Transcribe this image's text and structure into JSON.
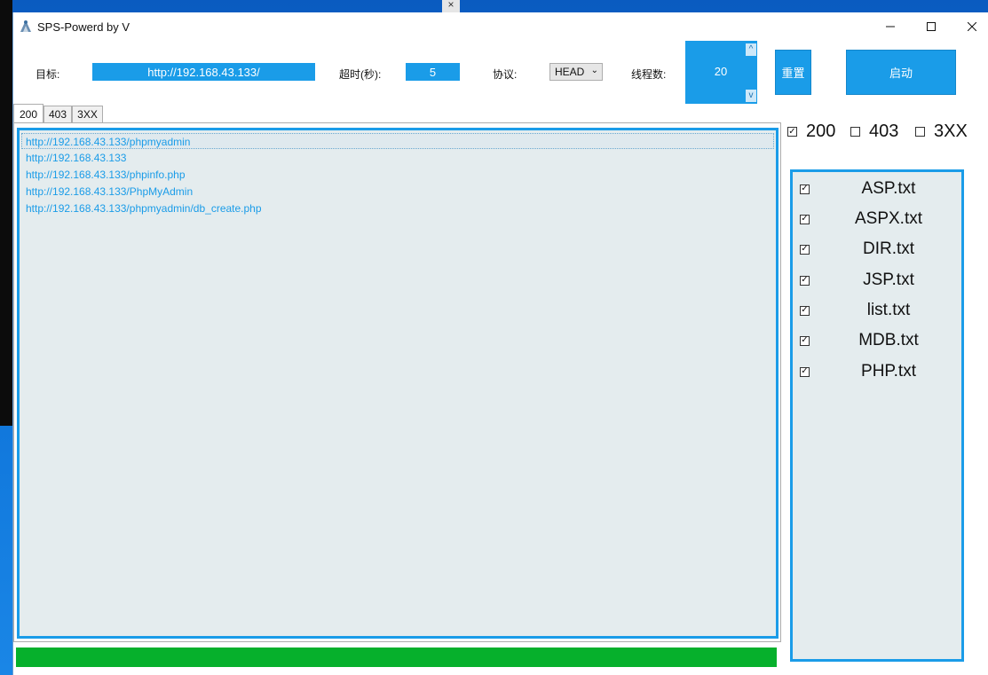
{
  "window": {
    "title": "SPS-Powerd by V"
  },
  "form": {
    "target_label": "目标:",
    "target_value": "http://192.168.43.133/",
    "timeout_label": "超时(秒):",
    "timeout_value": "5",
    "protocol_label": "协议:",
    "protocol_value": "HEAD",
    "threads_label": "线程数:",
    "threads_value": "20",
    "reset_label": "重置",
    "start_label": "启动"
  },
  "tabs": [
    {
      "label": "200",
      "active": true
    },
    {
      "label": "403",
      "active": false
    },
    {
      "label": "3XX",
      "active": false
    }
  ],
  "results": [
    "http://192.168.43.133/phpmyadmin",
    "http://192.168.43.133",
    "http://192.168.43.133/phpinfo.php",
    "http://192.168.43.133/PhpMyAdmin",
    "http://192.168.43.133/phpmyadmin/db_create.php"
  ],
  "progress_percent": 100,
  "status_filters": [
    {
      "label": "200",
      "checked": true
    },
    {
      "label": "403",
      "checked": false
    },
    {
      "label": "3XX",
      "checked": false
    }
  ],
  "dictionaries": [
    {
      "name": "ASP.txt",
      "checked": true
    },
    {
      "name": "ASPX.txt",
      "checked": true
    },
    {
      "name": "DIR.txt",
      "checked": true
    },
    {
      "name": "JSP.txt",
      "checked": true
    },
    {
      "name": "list.txt",
      "checked": true
    },
    {
      "name": "MDB.txt",
      "checked": true
    },
    {
      "name": "PHP.txt",
      "checked": true
    }
  ],
  "colors": {
    "accent": "#1a9ce8",
    "progress": "#06b02c",
    "panel_bg": "#e4ecee"
  }
}
